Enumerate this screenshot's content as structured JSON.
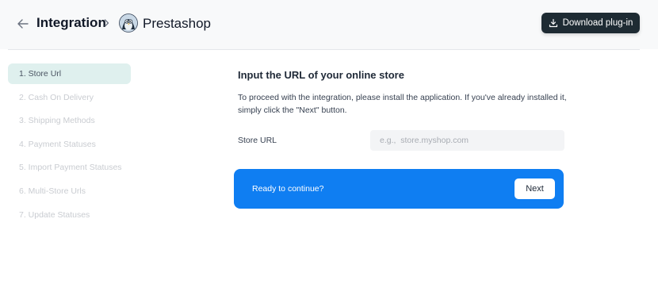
{
  "header": {
    "title": "Integration",
    "platform_name": "Prestashop",
    "download_label": "Download plug-in",
    "icons": {
      "back": "arrow-left-icon",
      "separator": "chevron-right-icon",
      "logo": "prestashop-logo",
      "download": "download-icon"
    }
  },
  "steps": [
    {
      "label": "1.  Store Url",
      "active": true
    },
    {
      "label": "2.  Cash On Delivery",
      "active": false
    },
    {
      "label": "3.  Shipping Methods",
      "active": false
    },
    {
      "label": "4.  Payment Statuses",
      "active": false
    },
    {
      "label": "5.  Import Payment Statuses",
      "active": false
    },
    {
      "label": "6.  Multi-Store Urls",
      "active": false
    },
    {
      "label": "7.  Update Statuses",
      "active": false
    }
  ],
  "main": {
    "section_title": "Input the URL of your online store",
    "description": "To proceed with the integration, please install the application. If you've already installed it, simply click the \"Next\" button.",
    "store_url_label": "Store URL",
    "store_url_value": "",
    "store_url_placeholder": "e.g.,  store.myshop.com"
  },
  "banner": {
    "text": "Ready to continue?",
    "next_label": "Next"
  },
  "colors": {
    "accent": "#0f7ef2",
    "active_step_bg": "#dff0ee",
    "download_button_bg": "#1e2b33"
  }
}
